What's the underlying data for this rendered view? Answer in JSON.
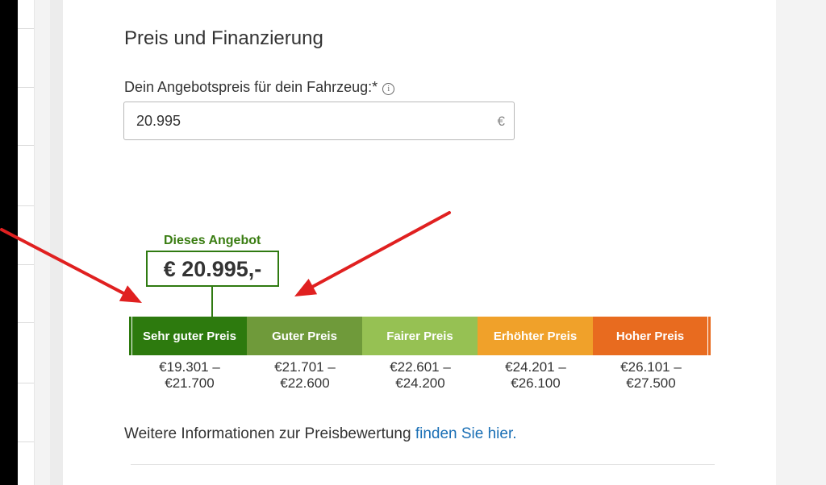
{
  "section": {
    "title": "Preis und Finanzierung"
  },
  "price_field": {
    "label": "Dein Angebotspreis für dein Fahrzeug:*",
    "info_icon": "info-icon",
    "value": "20.995",
    "suffix": "€"
  },
  "offer_marker": {
    "label": "Dieses Angebot",
    "price": "€ 20.995,-",
    "color": "#2f7a11"
  },
  "price_scale": [
    {
      "label": "Sehr guter Preis",
      "color": "#2d7a0e",
      "range_from": "€19.301 –",
      "range_to": "€21.700"
    },
    {
      "label": "Guter Preis",
      "color": "#6f9a3a",
      "range_from": "€21.701 –",
      "range_to": "€22.600"
    },
    {
      "label": "Fairer Preis",
      "color": "#96c153",
      "range_from": "€22.601 –",
      "range_to": "€24.200"
    },
    {
      "label": "Erhöhter Preis",
      "color": "#f0a12a",
      "range_from": "€24.201 –",
      "range_to": "€26.100"
    },
    {
      "label": "Hoher Preis",
      "color": "#e86b1f",
      "range_from": "€26.101 –",
      "range_to": "€27.500"
    }
  ],
  "more_info": {
    "text": "Weitere Informationen zur Preisbewertung ",
    "link_text": "finden Sie hier."
  },
  "annotation_color": "#e02020"
}
